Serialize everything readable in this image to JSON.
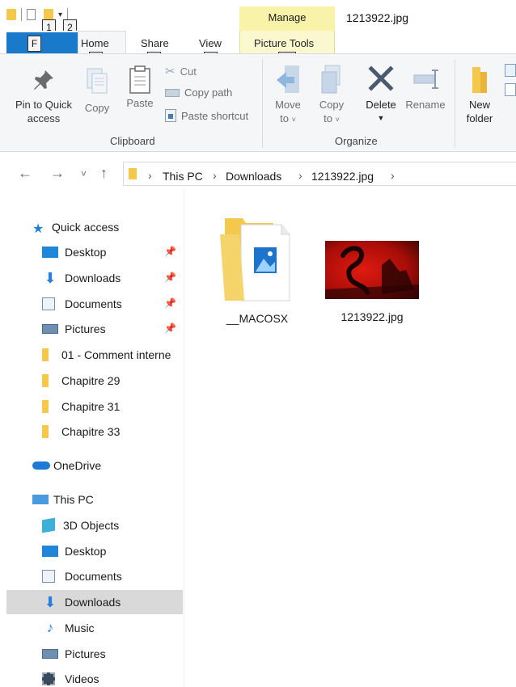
{
  "title_bar": {
    "manage_label": "Manage",
    "window_title": "1213922.jpg"
  },
  "keytips": {
    "file": "F",
    "qat_1": "1",
    "qat_2": "2",
    "home": "H",
    "share": "S",
    "view": "V",
    "picture_tools": "JP"
  },
  "tabs": {
    "home": "Home",
    "share": "Share",
    "view": "View",
    "picture_tools": "Picture Tools"
  },
  "ribbon": {
    "pin_quick_access_line1": "Pin to Quick",
    "pin_quick_access_line2": "access",
    "copy": "Copy",
    "paste": "Paste",
    "cut": "Cut",
    "copy_path": "Copy path",
    "paste_shortcut": "Paste shortcut",
    "clipboard_group": "Clipboard",
    "move_to_line1": "Move",
    "move_to_line2": "to",
    "copy_to_line1": "Copy",
    "copy_to_line2": "to",
    "delete": "Delete",
    "rename": "Rename",
    "organize_group": "Organize",
    "new_folder_line1": "New",
    "new_folder_line2": "folder"
  },
  "address": {
    "crumbs": [
      "This PC",
      "Downloads",
      "1213922.jpg"
    ]
  },
  "nav_pane": {
    "quick_access": "Quick access",
    "qa_items": [
      "Desktop",
      "Downloads",
      "Documents",
      "Pictures"
    ],
    "folders": [
      "01 - Comment interne",
      "Chapitre 29",
      "Chapitre 31",
      "Chapitre 33"
    ],
    "onedrive": "OneDrive",
    "this_pc": "This PC",
    "pc_items": [
      "3D Objects",
      "Desktop",
      "Documents",
      "Downloads",
      "Music",
      "Pictures",
      "Videos"
    ]
  },
  "files": [
    {
      "name": "__MACOSX"
    },
    {
      "name": "1213922.jpg"
    }
  ],
  "colors": {
    "file_tab": "#1979ca",
    "manage_tab": "#f9f3a9",
    "selection": "#d9d9d9",
    "folder": "#f4c84a"
  }
}
